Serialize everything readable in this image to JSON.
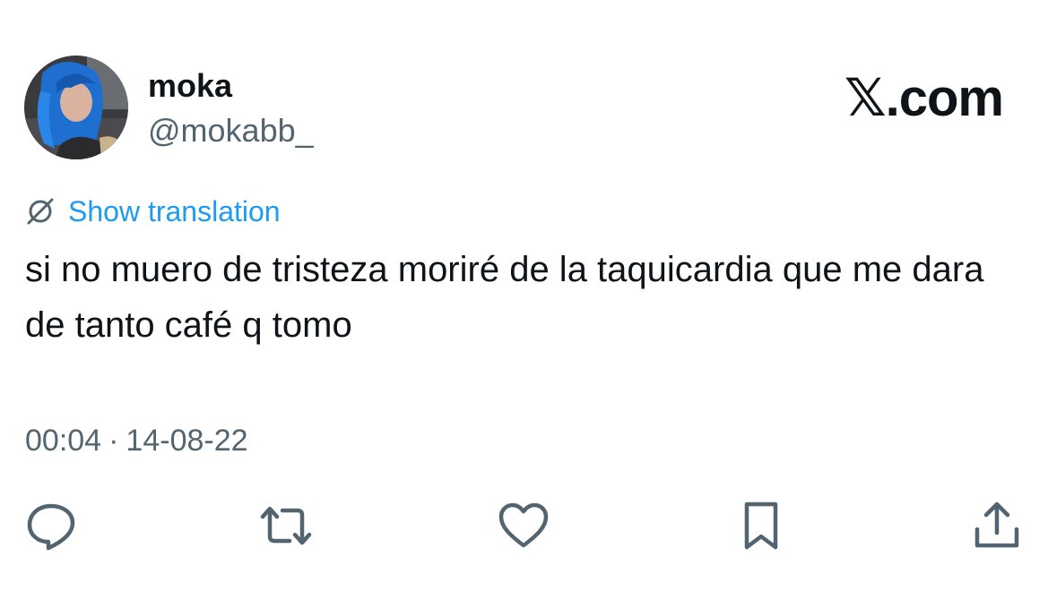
{
  "author": {
    "display_name": "moka",
    "handle": "@mokabb_"
  },
  "brand": {
    "label": "𝕏.com"
  },
  "translation": {
    "label": "Show translation",
    "icon": "translate-icon"
  },
  "tweet": {
    "text": "si no muero de tristeza moriré de la taquicardia que me dara de tanto café q tomo",
    "time": "00:04",
    "separator": "·",
    "date": "14-08-22"
  },
  "actions": {
    "icons": [
      "reply-icon",
      "retweet-icon",
      "like-icon",
      "bookmark-icon",
      "share-icon"
    ]
  },
  "colors": {
    "text": "#0f1419",
    "secondary": "#536471",
    "link": "#1d9bf0",
    "background": "#ffffff"
  }
}
